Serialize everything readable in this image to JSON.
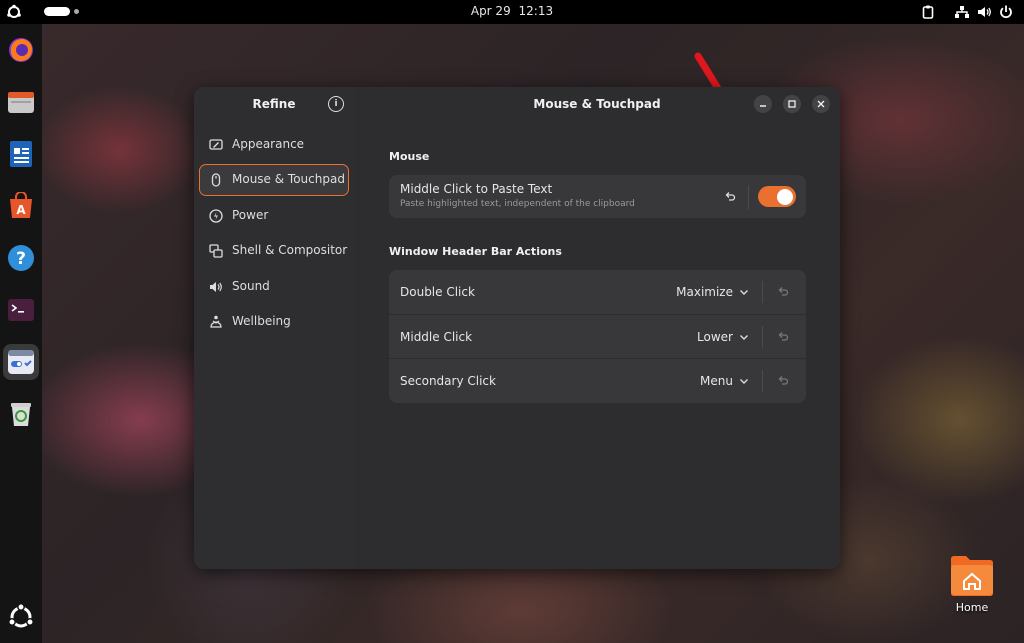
{
  "topbar": {
    "date": "Apr 29",
    "time": "12:13"
  },
  "dock": {
    "apps": [
      {
        "icon": "firefox-icon",
        "running": false
      },
      {
        "icon": "files-icon",
        "running": false
      },
      {
        "icon": "writer-icon",
        "running": false
      },
      {
        "icon": "app-center-icon",
        "running": false
      },
      {
        "icon": "help-icon",
        "running": false
      },
      {
        "icon": "terminal-icon",
        "running": false
      },
      {
        "icon": "refine-icon",
        "running": true
      },
      {
        "icon": "trash-icon",
        "running": false
      }
    ],
    "bottom_icon": "ubuntu-icon"
  },
  "window": {
    "sidebar_title": "Refine",
    "title": "Mouse & Touchpad",
    "accent_color": "#e9702f",
    "nav": [
      {
        "label": "Appearance",
        "icon": "appearance-icon"
      },
      {
        "label": "Mouse & Touchpad",
        "icon": "mouse-icon",
        "selected": true
      },
      {
        "label": "Power",
        "icon": "power-icon"
      },
      {
        "label": "Shell & Compositor",
        "icon": "shell-icon"
      },
      {
        "label": "Sound",
        "icon": "sound-icon"
      },
      {
        "label": "Wellbeing",
        "icon": "wellbeing-icon"
      }
    ],
    "mouse_section": {
      "heading": "Mouse",
      "middle_click_paste": {
        "title": "Middle Click to Paste Text",
        "subtitle": "Paste highlighted text, independent of the clipboard",
        "enabled": true
      }
    },
    "header_bar_section": {
      "heading": "Window Header Bar Actions",
      "rows": [
        {
          "title": "Double Click",
          "value": "Maximize"
        },
        {
          "title": "Middle Click",
          "value": "Lower"
        },
        {
          "title": "Secondary Click",
          "value": "Menu"
        }
      ]
    }
  },
  "desktop": {
    "home_label": "Home"
  }
}
